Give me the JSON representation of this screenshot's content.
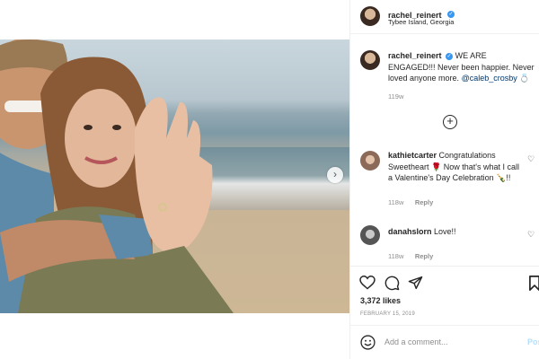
{
  "post": {
    "username": "rachel_reinert",
    "location": "Tybee Island, Georgia",
    "caption_text": "WE ARE ENGAGED!!! Never been happier. Never loved anyone more.",
    "caption_mention": "@caleb_crosby",
    "caption_emoji": "💍",
    "caption_age": "119w",
    "likes": "3,372 likes",
    "date": "FEBRUARY 15, 2019"
  },
  "comments": [
    {
      "username": "kathietcarter",
      "text": "Congratulations Sweetheart 🌹 Now that's what I call a Valentine's Day Celebration 🍾!!",
      "age": "118w",
      "reply_label": "Reply"
    },
    {
      "username": "danahslorn",
      "text": "Love!!",
      "age": "118w",
      "reply_label": "Reply"
    }
  ],
  "composer": {
    "placeholder": "Add a comment...",
    "post_label": "Post"
  },
  "icons": {
    "next": "›",
    "load_more": "+",
    "verified": "✓",
    "heart": "♡"
  },
  "colors": {
    "verified": "#3897f0",
    "mention": "#00376b",
    "muted": "#8e8e8e"
  }
}
